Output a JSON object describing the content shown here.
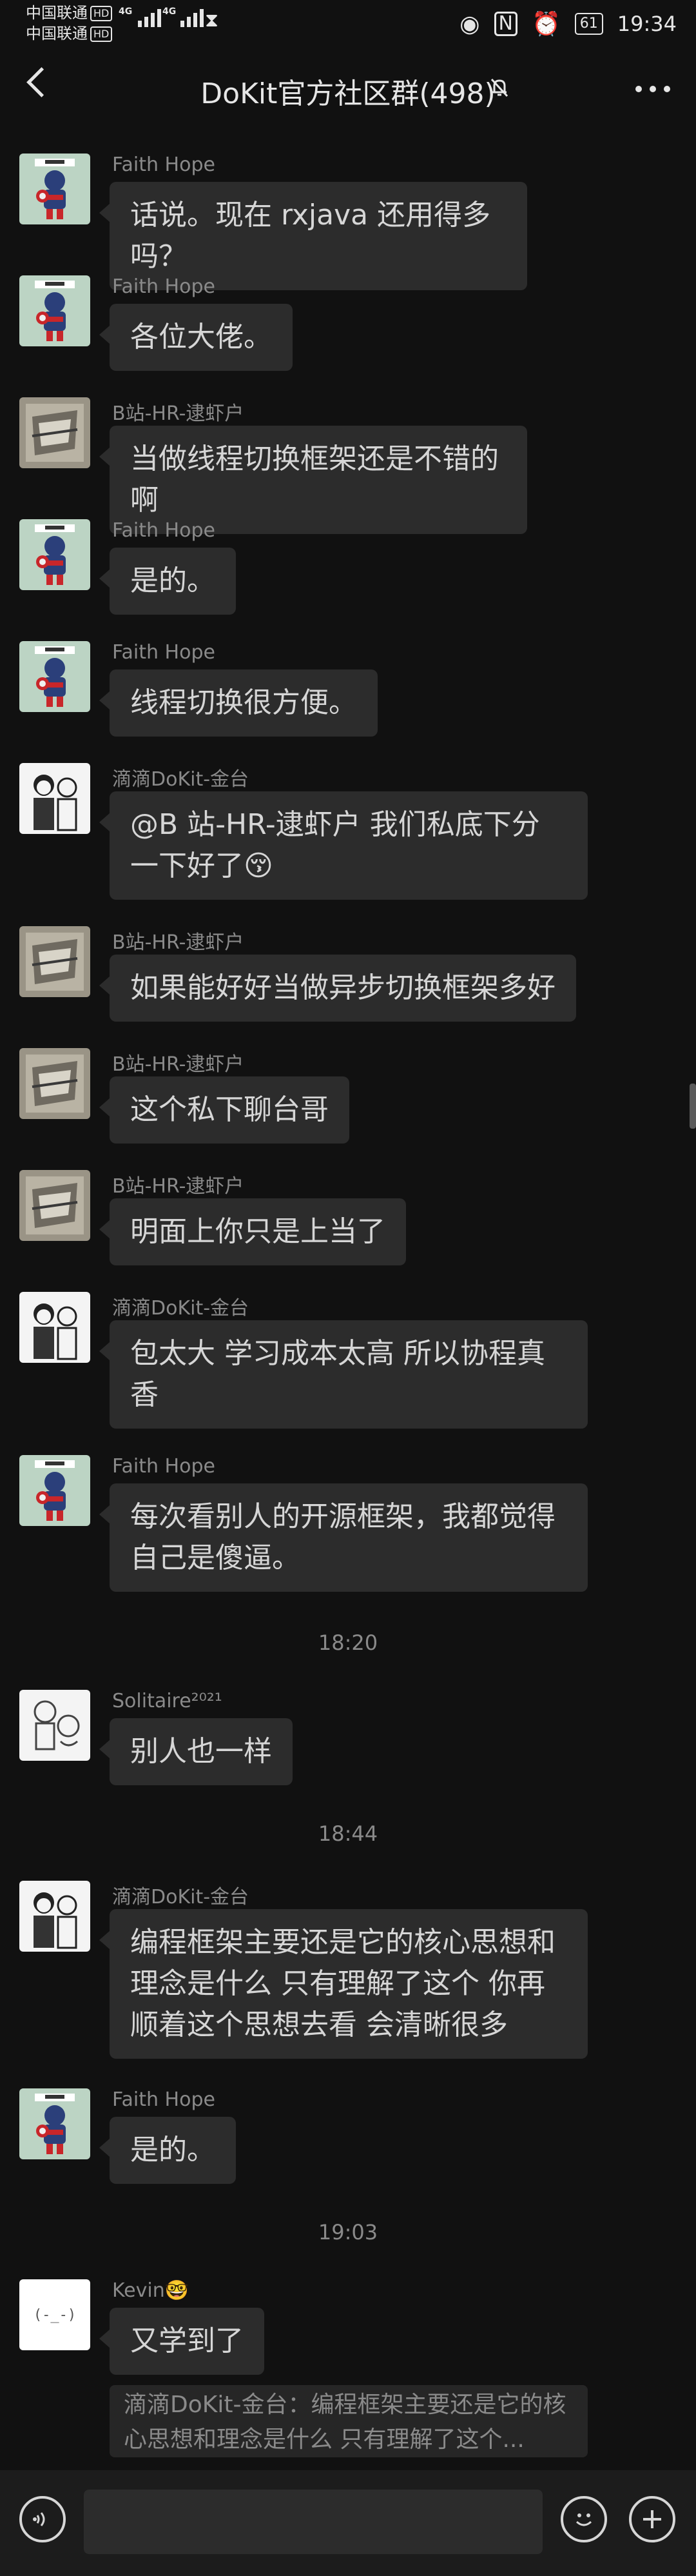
{
  "status_bar": {
    "carrier_1": "中国联通",
    "carrier_2": "中国联通",
    "hd": "HD",
    "network": "4G",
    "battery": "61",
    "time": "19:34"
  },
  "header": {
    "title": "DoKit官方社区群(498)"
  },
  "messages": [
    {
      "sender": "Faith Hope",
      "text": "话说。现在 rxjava 还用得多吗？"
    },
    {
      "sender": "Faith Hope",
      "text": "各位大佬。"
    },
    {
      "sender": "B站-HR-逮虾户",
      "text": "当做线程切换框架还是不错的啊"
    },
    {
      "sender": "Faith Hope",
      "text": "是的。"
    },
    {
      "sender": "Faith Hope",
      "text": "线程切换很方便。"
    },
    {
      "sender": "滴滴DoKit-金台",
      "text": "@B 站-HR-逮虾户  我们私底下分一下好了😚"
    },
    {
      "sender": "B站-HR-逮虾户",
      "text": "如果能好好当做异步切换框架多好"
    },
    {
      "sender": "B站-HR-逮虾户",
      "text": "这个私下聊台哥"
    },
    {
      "sender": "B站-HR-逮虾户",
      "text": "明面上你只是上当了"
    },
    {
      "sender": "滴滴DoKit-金台",
      "text": "包太大 学习成本太高 所以协程真香"
    },
    {
      "sender": "Faith Hope",
      "text": "每次看别人的开源框架，我都觉得自己是傻逼。"
    },
    {
      "sender": "Solitaire²⁰²¹",
      "text": "别人也一样"
    },
    {
      "sender": "滴滴DoKit-金台",
      "text": "编程框架主要还是它的核心思想和理念是什么 只有理解了这个 你再顺着这个思想去看 会清晰很多"
    },
    {
      "sender": "Faith Hope",
      "text": "是的。"
    },
    {
      "sender": "Kevin🤓",
      "text": "又学到了"
    }
  ],
  "timestamps": [
    "18:20",
    "18:44",
    "19:03"
  ],
  "quote": {
    "text": "滴滴DoKit-金台：编程框架主要还是它的核心思想和理念是什么 只有理解了这个..."
  },
  "input_bar": {
    "voice_icon": "voice-icon",
    "emoji_icon": "emoji-icon",
    "plus_icon": "plus-icon"
  },
  "colors": {
    "background": "#111111",
    "bubble": "#2c2c2c",
    "text": "#d6d6d6",
    "secondary_text": "#8a8a8a"
  }
}
